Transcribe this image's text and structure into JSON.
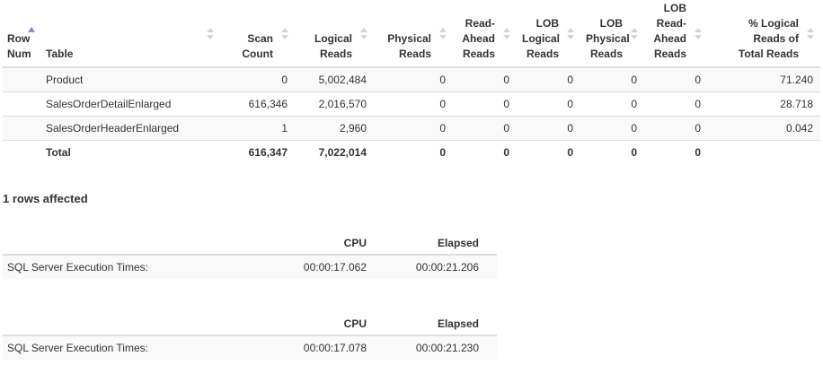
{
  "io_table": {
    "headers": {
      "row_num": [
        "Row",
        "Num"
      ],
      "table": "Table",
      "scan_count": [
        "Scan",
        "Count"
      ],
      "logical_reads": [
        "Logical",
        "Reads"
      ],
      "physical_reads": [
        "Physical",
        "Reads"
      ],
      "read_ahead_reads": [
        "Read-",
        "Ahead",
        "Reads"
      ],
      "lob_logical_reads": [
        "LOB",
        "Logical",
        "Reads"
      ],
      "lob_physical_reads": [
        "LOB",
        "Physical",
        "Reads"
      ],
      "lob_read_ahead_reads": [
        "LOB",
        "Read-",
        "Ahead",
        "Reads"
      ],
      "pct_logical_reads": [
        "% Logical",
        "Reads of",
        "Total Reads"
      ]
    },
    "rows": [
      {
        "row_num": "",
        "table": "Product",
        "scan_count": "0",
        "logical_reads": "5,002,484",
        "physical_reads": "0",
        "read_ahead_reads": "0",
        "lob_logical_reads": "0",
        "lob_physical_reads": "0",
        "lob_read_ahead_reads": "0",
        "pct_logical_reads": "71.240"
      },
      {
        "row_num": "",
        "table": "SalesOrderDetailEnlarged",
        "scan_count": "616,346",
        "logical_reads": "2,016,570",
        "physical_reads": "0",
        "read_ahead_reads": "0",
        "lob_logical_reads": "0",
        "lob_physical_reads": "0",
        "lob_read_ahead_reads": "0",
        "pct_logical_reads": "28.718"
      },
      {
        "row_num": "",
        "table": "SalesOrderHeaderEnlarged",
        "scan_count": "1",
        "logical_reads": "2,960",
        "physical_reads": "0",
        "read_ahead_reads": "0",
        "lob_logical_reads": "0",
        "lob_physical_reads": "0",
        "lob_read_ahead_reads": "0",
        "pct_logical_reads": "0.042"
      }
    ],
    "total": {
      "label": "Total",
      "scan_count": "616,347",
      "logical_reads": "7,022,014",
      "physical_reads": "0",
      "read_ahead_reads": "0",
      "lob_logical_reads": "0",
      "lob_physical_reads": "0",
      "lob_read_ahead_reads": "0",
      "pct_logical_reads": ""
    },
    "sort_indicator_color": "#7f8fbd",
    "sort_icon_color": "#d4d4d4",
    "stripe_color": "#f9f9f9",
    "border_color": "#dddddd"
  },
  "rows_affected": "1 rows affected",
  "execution_times": [
    {
      "headers": {
        "label": "",
        "cpu": "CPU",
        "elapsed": "Elapsed"
      },
      "label": "SQL Server Execution Times:",
      "cpu": "00:00:17.062",
      "elapsed": "00:00:21.206"
    },
    {
      "headers": {
        "label": "",
        "cpu": "CPU",
        "elapsed": "Elapsed"
      },
      "label": "SQL Server Execution Times:",
      "cpu": "00:00:17.078",
      "elapsed": "00:00:21.230"
    }
  ]
}
